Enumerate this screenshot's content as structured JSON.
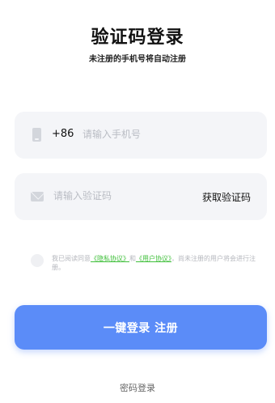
{
  "header": {
    "title": "验证码登录",
    "subtitle": "未注册的手机号将自动注册"
  },
  "phone": {
    "icon": "phone-icon",
    "country_code": "+86",
    "placeholder": "请输入手机号",
    "value": ""
  },
  "code": {
    "icon": "mail-icon",
    "placeholder": "请输入验证码",
    "value": "",
    "get_code_label": "获取验证码"
  },
  "agreement": {
    "checked": false,
    "prefix": "我已阅读同意",
    "privacy_link": "《隐私协议》",
    "and": "和",
    "user_link": "《用户协议》",
    "suffix": "，尚未注册的用户将会进行注册。"
  },
  "actions": {
    "login_label": "一键登录 注册",
    "password_login_label": "密码登录"
  },
  "colors": {
    "primary": "#5b8cf8",
    "link": "#3fbf3a",
    "field_bg": "#f4f5f8"
  }
}
